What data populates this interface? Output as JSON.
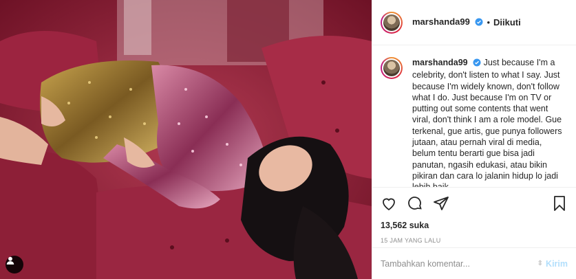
{
  "post": {
    "username": "marshanda99",
    "follow_status": "Diikuti",
    "dot": "•",
    "caption": "Just because I'm a celebrity, don't listen to what I say. Just because I'm widely known, don't follow what I do. Just because I'm on TV or putting out some contents that went viral, don't think I am a role model. Gue terkenal, gue artis, gue punya followers jutaan, atau pernah viral di media, belum tentu berarti gue bisa jadi panutan, ngasih edukasi, atau bikin pikiran dan cara lo jalanin hidup lo jadi lebih baik.",
    "likes": "13,562 suka",
    "time": "15 JAM YANG LALU"
  },
  "comment": {
    "placeholder": "Tambahkan komentar...",
    "post_label": "Kirim"
  },
  "icons": {
    "like": "heart-icon",
    "comment": "comment-icon",
    "share": "share-icon",
    "save": "bookmark-icon",
    "verified": "verified-badge-icon",
    "user_tag": "user-tag-icon"
  },
  "colors": {
    "verified": "#3897f0",
    "post_button": "#b2dffc",
    "muted": "#8e8e8e"
  }
}
